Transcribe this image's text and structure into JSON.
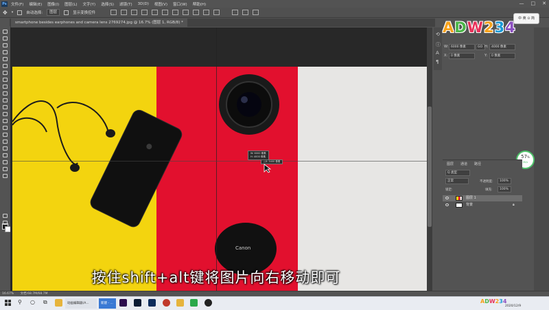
{
  "menubar": {
    "logo": "Ps",
    "items": [
      "文件(F)",
      "编辑(E)",
      "图像(I)",
      "图层(L)",
      "文字(Y)",
      "选择(S)",
      "滤镜(T)",
      "3D(D)",
      "视图(V)",
      "窗口(W)",
      "帮助(H)"
    ],
    "window_controls": [
      "—",
      "□",
      "✕"
    ]
  },
  "optionsbar": {
    "auto_select_label": "自动选择:",
    "auto_select_value": "图层",
    "show_transform_label": "显示变换控件"
  },
  "document": {
    "tab_title": "smartphone besides earphones and camera lens 2769274.jpg @ 16.7% (图层 1, RGB/8) *"
  },
  "properties": {
    "w_label": "W:",
    "w_value": "6000 像素",
    "link": "GO",
    "h_label": "H:",
    "h_value": "4000 像素",
    "x_label": "X:",
    "x_value": "0 像素",
    "y_label": "Y:",
    "y_value": "0 像素"
  },
  "layers": {
    "tabs": [
      "图层",
      "通道",
      "路径"
    ],
    "kind_label": "Q 类型",
    "blend_mode": "正常",
    "opacity_label": "不透明度:",
    "opacity_value": "100%",
    "lock_label": "锁定:",
    "fill_label": "填充:",
    "fill_value": "100%",
    "rows": [
      {
        "name": "图层 1"
      },
      {
        "name": "背景"
      }
    ]
  },
  "logo": {
    "chars": [
      "A",
      "D",
      "W",
      "2",
      "3",
      "4"
    ],
    "colors": [
      "#f7a21b",
      "#4cb648",
      "#e8325a",
      "#f7a21b",
      "#1c9bd7",
      "#8c4fc0"
    ]
  },
  "ime": {
    "text": "中 英 ⊙ 简"
  },
  "gauge": {
    "value": "57",
    "unit": "%",
    "sub": "0K/s"
  },
  "tooltip": {
    "line1": "W: 6000 像素",
    "line2": "H: 4000 像素",
    "line3": "△X: 3400 像素"
  },
  "statusbar": {
    "zoom": "16.67%",
    "doc": "文档:68.7M/68.7M"
  },
  "subtitle": "按住shift+alt键将图片向右移动即可",
  "taskbar": {
    "app1": "动画编辑器(A...",
    "app2": "新建 - ...",
    "time": "2020/12/9"
  },
  "accent_colors": {
    "yellow": "#f3d40f",
    "red": "#e2102e",
    "white": "#e7e6e4"
  }
}
